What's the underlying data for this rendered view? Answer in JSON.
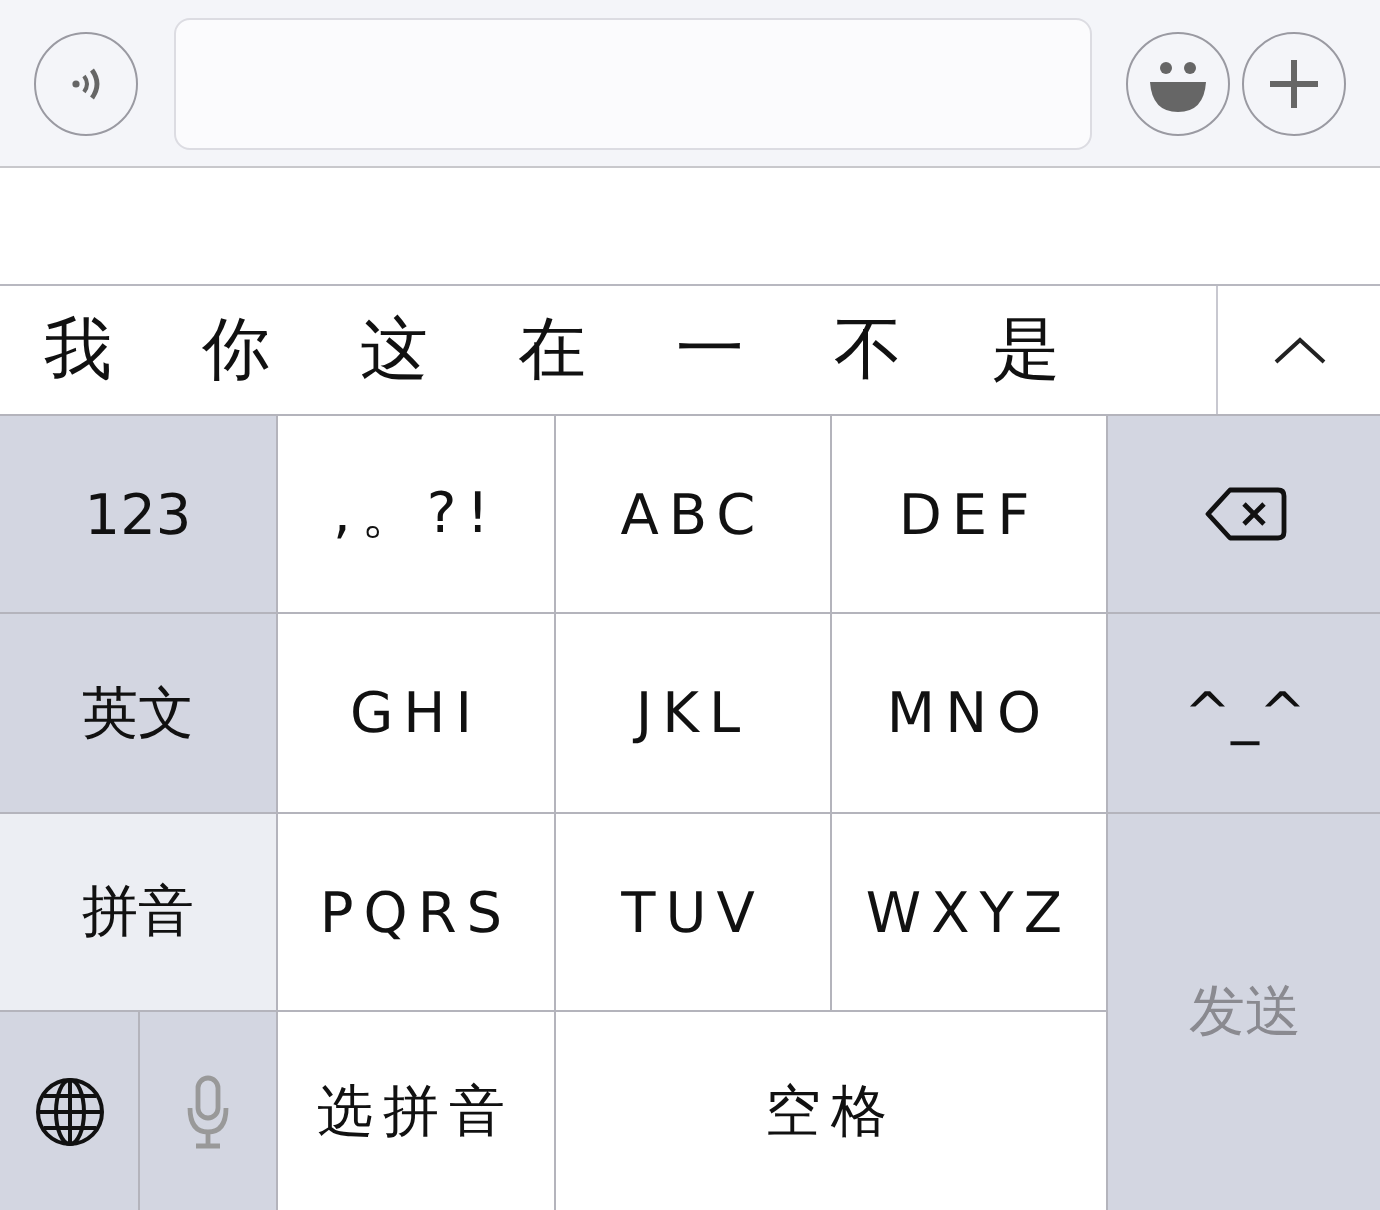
{
  "candidates": [
    "我",
    "你",
    "这",
    "在",
    "一",
    "不",
    "是"
  ],
  "keys": [
    {
      "kind": "mode",
      "label": "123",
      "selected": false
    },
    {
      "kind": "letter",
      "label": ",。?!"
    },
    {
      "kind": "letter",
      "label": "ABC"
    },
    {
      "kind": "letter",
      "label": "DEF"
    },
    {
      "kind": "delete"
    },
    {
      "kind": "mode",
      "label": "英文",
      "selected": false
    },
    {
      "kind": "letter",
      "label": "GHI"
    },
    {
      "kind": "letter",
      "label": "JKL"
    },
    {
      "kind": "letter",
      "label": "MNO"
    },
    {
      "kind": "emoticon",
      "label": "^_^"
    },
    {
      "kind": "mode",
      "label": "拼音",
      "selected": true
    },
    {
      "kind": "letter",
      "label": "PQRS"
    },
    {
      "kind": "letter",
      "label": "TUV"
    },
    {
      "kind": "letter",
      "label": "WXYZ"
    },
    {
      "kind": "send",
      "label": "发送",
      "disabled": true
    },
    {
      "kind": "globe"
    },
    {
      "kind": "mic"
    },
    {
      "kind": "letter",
      "label": "选拼音"
    },
    {
      "kind": "space",
      "label": "空格"
    }
  ]
}
